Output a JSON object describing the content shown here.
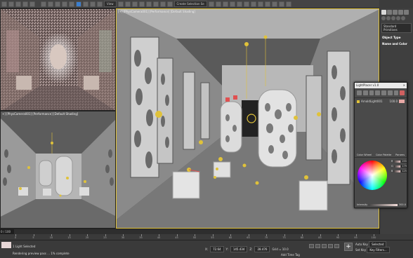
{
  "toolbar": {
    "view_dropdown": "View",
    "selection_set": "Create Selection Se"
  },
  "viewports": {
    "top_left": {
      "label": ""
    },
    "main": {
      "label": "[+] [PhysCamera001] [Performance] [Default Shading]"
    },
    "bottom_left": {
      "label": "+] [PhysCamera001] [Performance] [Default Shading]"
    }
  },
  "command_panel": {
    "dropdown": "Standard Primitives",
    "rollout1": "Object Type",
    "rollout2": "Name and Color"
  },
  "light_placer": {
    "title": "LightPlacer v1.0",
    "light_name": "ArnoldLight001",
    "light_value": "100.0",
    "tabs": [
      "Color Wheel",
      "Color Palette",
      "Params"
    ],
    "sliders": [
      {
        "label": "R",
        "value": "255"
      },
      {
        "label": "G",
        "value": "179"
      },
      {
        "label": "B",
        "value": "125"
      }
    ],
    "intensity_label": "Intensity",
    "intensity_value": "300.0"
  },
  "timeline": {
    "frame": "0 / 100",
    "ticks": [
      "0",
      "5",
      "10",
      "15",
      "20",
      "25",
      "30",
      "35",
      "40",
      "45",
      "50",
      "55",
      "60",
      "65",
      "70",
      "75",
      "80",
      "85",
      "90",
      "95",
      "100"
    ]
  },
  "status": {
    "selected": "1 Light Selected",
    "prompt": "Rendering preview pass ... 1% complete",
    "x_label": "X:",
    "x_value": "72.64",
    "y_label": "Y:",
    "y_value": "145.434",
    "z_label": "Z:",
    "z_value": "28.476",
    "grid": "Grid = 10.0",
    "add_time_tag": "Add Time Tag",
    "auto_key": "Auto Key",
    "auto_key_mode": "Selected",
    "set_key": "Set Key",
    "key_filters": "Key Filters..."
  },
  "colors": {
    "accent_yellow": "#e0c23a",
    "light_color": "#e8a9a6",
    "scene_gray": "#5a5a5a"
  }
}
